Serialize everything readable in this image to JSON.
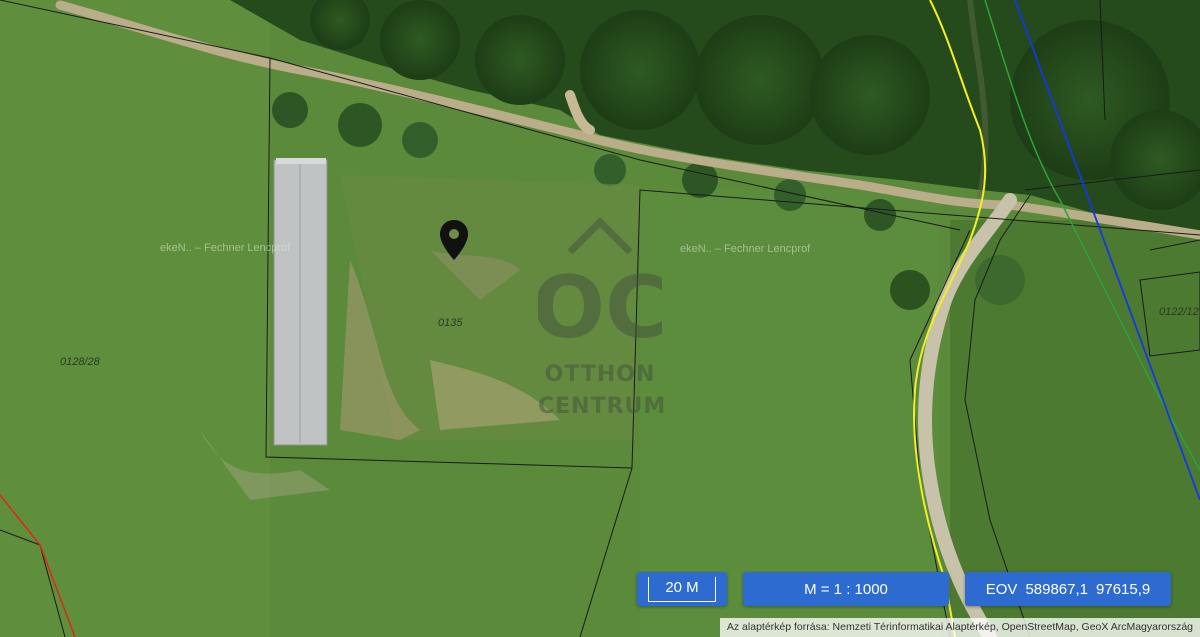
{
  "map": {
    "parcels": [
      {
        "id": "parcel-0128-28",
        "label": "0128/28"
      },
      {
        "id": "parcel-0135",
        "label": "0135"
      },
      {
        "id": "parcel-0122-12",
        "label": "0122/12"
      }
    ],
    "ghost_labels": [
      "ekeN.. – Fechner Lencprof",
      "ekeN.. – Fechner Lencprof"
    ],
    "pin_icon": "map-pin-icon"
  },
  "watermark": {
    "logo_letters": "OC",
    "line1": "OTTHON",
    "line2": "CENTRUM"
  },
  "controls": {
    "scale_bar_label": "20 M",
    "ratio_label": "M = 1 : 1000",
    "eov_label": "EOV",
    "eov_x": "589867,1",
    "eov_y": "97615,9",
    "accent_color": "#2e6bd1"
  },
  "attribution": "Az alaptérkép forrása: Nemzeti Térinformatikai Alaptérkép, OpenStreetMap, GeoX ArcMagyarország"
}
